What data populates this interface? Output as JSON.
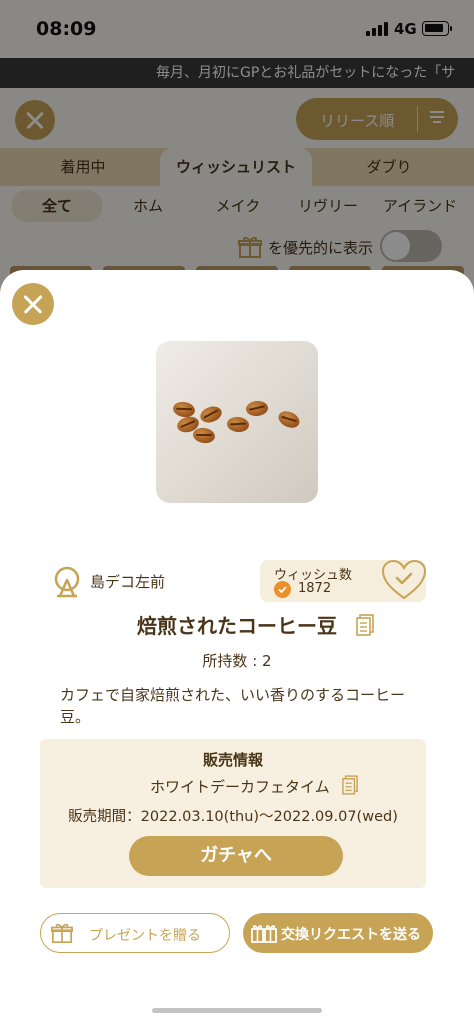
{
  "status_bar": {
    "time": "08:09",
    "network": "4G"
  },
  "ticker": {
    "text": "毎月、月初にGPとお礼品がセットになった「サ"
  },
  "list_screen": {
    "sort_label": "リリース順",
    "tabs": [
      "着用中",
      "ウィッシュリスト",
      "ダブり"
    ],
    "active_tab": "ウィッシュリスト",
    "filters": [
      "全て",
      "ホム",
      "メイク",
      "リヴリー",
      "アイランド"
    ],
    "active_filter": "全て",
    "priority_label": "を優先的に表示",
    "priority_toggle_on": false
  },
  "item": {
    "category": "島デコ左前",
    "wish_label": "ウィッシュ数",
    "wish_count": "1872",
    "name": "焙煎されたコーヒー豆",
    "owned": "所持数 : 2",
    "description": "カフェで自家焙煎された、いい香りのするコーヒー豆。",
    "sale": {
      "heading": "販売情報",
      "event": "ホワイトデーカフェタイム",
      "period": "販売期間：2022.03.10(thu)〜2022.09.07(wed)",
      "gacha_button": "ガチャへ"
    },
    "present_button": "プレゼントを贈る",
    "exchange_button": "交換リクエストを送る"
  },
  "colors": {
    "accent": "#c7a356",
    "text": "#4a3518",
    "wish_bg": "#f6eedc",
    "sale_bg": "#f7f0e0"
  },
  "icons": [
    "close-icon",
    "sort-icon",
    "gift-icon",
    "stand-icon",
    "heart-check-icon",
    "document-icon",
    "exchange-icon"
  ]
}
